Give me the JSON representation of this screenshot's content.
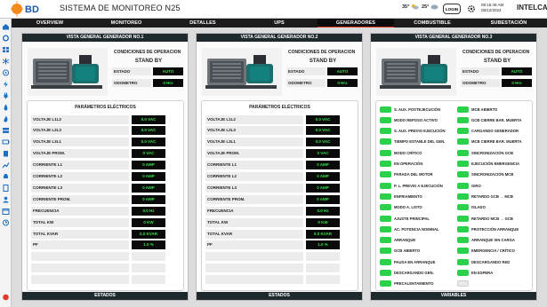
{
  "header": {
    "logo_text": "BD",
    "title": "SISTEMA DE MONITOREO N25",
    "weather1": "35°",
    "weather2": "25°",
    "login": "LOGIN",
    "time": "09:15:49 AM",
    "date": "05/12/2024",
    "brand": "INTELCA"
  },
  "nav": [
    "OVERVIEW",
    "MONITOREO",
    "DETALLES",
    "UPS",
    "GENERADORES",
    "COMBUSTIBLE",
    "SUBESTACIÓN"
  ],
  "nav_active": 4,
  "panels": [
    {
      "title": "VISTA GENERAL GENERADOR NO.1",
      "cond_title": "CONDICIONES DE OPERACION",
      "stand": "STAND BY",
      "estado_label": "ESTADO",
      "estado_val": "AUTO",
      "odometro_label": "ODOMETRO",
      "odometro_val": "0 Hrs",
      "params_title": "PARÁMETROS ELÉCTRICOS",
      "footer": "ESTADOS",
      "params": [
        {
          "label": "VOLTAJE L1L2",
          "value": "0.0 VAC"
        },
        {
          "label": "VOLTAJE L2L3",
          "value": "0.0 VAC"
        },
        {
          "label": "VOLTAJE L3L1",
          "value": "0.0 VAC"
        },
        {
          "label": "VOLTAJE PROM.",
          "value": "0 VAC"
        },
        {
          "label": "CORRIENTE L1",
          "value": "0 AMP"
        },
        {
          "label": "CORRIENTE L2",
          "value": "0 AMP"
        },
        {
          "label": "CORRIENTE L3",
          "value": "0 AMP"
        },
        {
          "label": "CORRIENTE PROM.",
          "value": "0 AMP"
        },
        {
          "label": "FRECUENCIA",
          "value": "0.0 Hz"
        },
        {
          "label": "TOTAL KW",
          "value": "0 KW"
        },
        {
          "label": "TOTAL KVAR",
          "value": "0.0 KVAR"
        },
        {
          "label": "PF",
          "value": "1.0 %"
        }
      ]
    },
    {
      "title": "VISTA GENERAL GENERADOR NO.2",
      "cond_title": "CONDICIONES DE OPERACION",
      "stand": "STAND BY",
      "estado_label": "ESTADO",
      "estado_val": "AUTO",
      "odometro_label": "ODOMETRO",
      "odometro_val": "0 Hrs",
      "params_title": "PARÁMETROS ELÉCTRICOS",
      "footer": "ESTADOS",
      "params": [
        {
          "label": "VOLTAJE L1L2",
          "value": "0.0 VAC"
        },
        {
          "label": "VOLTAJE L2L3",
          "value": "0.0 VAC"
        },
        {
          "label": "VOLTAJE L3L1",
          "value": "0.0 VAC"
        },
        {
          "label": "VOLTAJE PROM.",
          "value": "0 VAC"
        },
        {
          "label": "CORRIENTE L1",
          "value": "0 AMP"
        },
        {
          "label": "CORRIENTE L2",
          "value": "0 AMP"
        },
        {
          "label": "CORRIENTE L3",
          "value": "0 AMP"
        },
        {
          "label": "CORRIENTE PROM.",
          "value": "0 AMP"
        },
        {
          "label": "FRECUENCIA",
          "value": "0.0 Hz"
        },
        {
          "label": "TOTAL KW",
          "value": "0 KW"
        },
        {
          "label": "TOTAL KVAR",
          "value": "0.0 KVAR"
        },
        {
          "label": "PF",
          "value": "1.0 %"
        }
      ]
    },
    {
      "title": "VISTA GENERAL GENERADOR NO.3",
      "cond_title": "CONDICIONES DE OPERACION",
      "stand": "STAND BY",
      "estado_label": "ESTADO",
      "estado_val": "AUTO",
      "odometro_label": "ODOMETRO",
      "odometro_val": "0 Hrs",
      "footer": "VARIABLES",
      "vars_left": [
        {
          "label": "S. AUX. POSTEJECUCIÓN",
          "on": true
        },
        {
          "label": "MODO REPOSO ACTIVO",
          "on": true
        },
        {
          "label": "S. AUX. PREVIO EJECUCIÓN",
          "on": true
        },
        {
          "label": "TIEMPO ESTABLE DEL GEN.",
          "on": true
        },
        {
          "label": "MODO CRÍTICO",
          "on": true
        },
        {
          "label": "EN OPERACIÓN",
          "on": true
        },
        {
          "label": "PARADA DEL MOTOR",
          "on": true
        },
        {
          "label": "P. L. PREVIO A EJECUCIÓN",
          "on": true
        },
        {
          "label": "ENFRIAMIENTO",
          "on": true
        },
        {
          "label": "MODO A. LISTO",
          "on": true
        },
        {
          "label": "AJUSTE PRINCIPAL",
          "on": true
        },
        {
          "label": "AC. POTENCIA NOMINAL",
          "on": true
        },
        {
          "label": "ARRANQUE",
          "on": true
        },
        {
          "label": "GCB ABIERTO",
          "on": true
        },
        {
          "label": "PAUSA EN ARRANQUE",
          "on": true
        },
        {
          "label": "DESCARGANDO GEN.",
          "on": true
        },
        {
          "label": "PRECALENTAMIENTO",
          "on": true
        }
      ],
      "vars_right": [
        {
          "label": "MCB ABIERTO",
          "on": true
        },
        {
          "label": "GCB CIERRE BAR. MUERTA",
          "on": true
        },
        {
          "label": "CARGANDO GENERADOR",
          "on": true
        },
        {
          "label": "MCB CIERRE BAR. MUERTA",
          "on": true
        },
        {
          "label": "SINCRONIZACIÓN GCB",
          "on": true
        },
        {
          "label": "EJECUCIÓN EMERGENCIA",
          "on": true
        },
        {
          "label": "SINCRONIZACIÓN MCB",
          "on": true
        },
        {
          "label": "GIRO",
          "on": true
        },
        {
          "label": "RETARDO GCB → MCB",
          "on": true
        },
        {
          "label": "ISLADO",
          "on": true
        },
        {
          "label": "RETARDO MCB → GCB",
          "on": true
        },
        {
          "label": "PROTECCIÓN ARRANQUE",
          "on": true
        },
        {
          "label": "ARRANQUE SIN CARGA",
          "on": true
        },
        {
          "label": "EMERGENCIA / CRÍTICO",
          "on": true
        },
        {
          "label": "DESCARGANDO RED",
          "on": true
        },
        {
          "label": "EN ESPERA",
          "on": true
        },
        {
          "label": "",
          "on": false
        }
      ]
    }
  ],
  "colors": {
    "accent": "#e03a2a",
    "on": "#2bd14a",
    "display_text": "#38e04a"
  }
}
